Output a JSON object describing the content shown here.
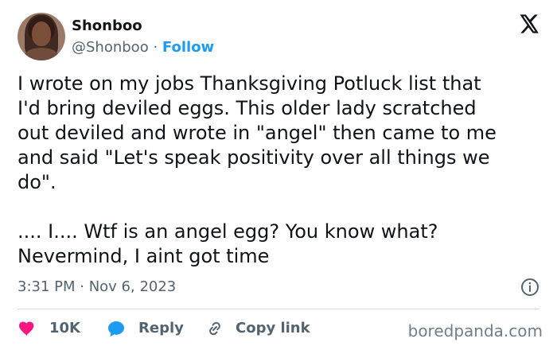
{
  "tweet": {
    "author": {
      "name": "Shonboo",
      "handle": "@Shonboo",
      "separator": "·",
      "follow_label": "Follow"
    },
    "text": "I wrote on my jobs Thanksgiving Potluck list that\nI'd bring deviled eggs. This older lady scratched\nout deviled and wrote in \"angel\" then came to me\nand said \"Let's speak positivity over all things we\ndo\".\n\n.... I.... Wtf is an angel egg? You know what?\nNevermind, I aint got time",
    "timestamp": "3:31 PM · Nov 6, 2023",
    "actions": {
      "like_count": "10K",
      "reply_label": "Reply",
      "copy_link_label": "Copy link"
    }
  },
  "watermark": "boredpanda.com",
  "icons": {
    "platform": "x-logo-icon",
    "info": "info-icon",
    "like": "heart-icon",
    "reply": "reply-bubble-icon",
    "copy_link": "link-icon"
  },
  "colors": {
    "primary_text": "#0f1419",
    "secondary_text": "#536471",
    "accent": "#1d9bf0",
    "like": "#f91880",
    "divider": "#cfd9de"
  }
}
